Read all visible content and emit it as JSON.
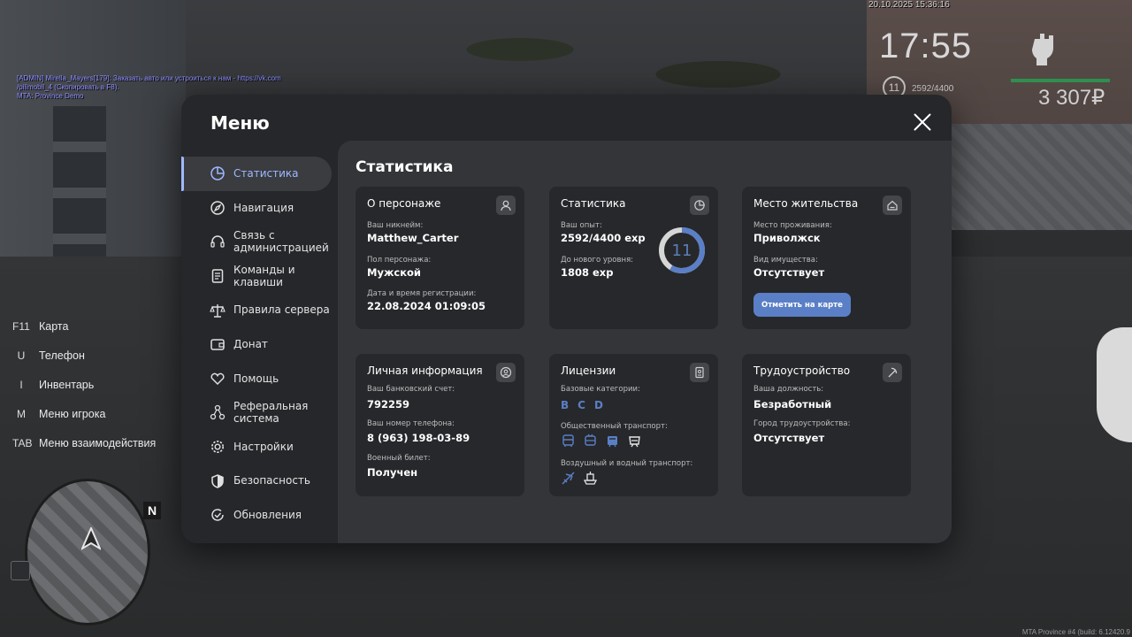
{
  "chat": [
    "[ADMIN] Mirella_Mayers[179]: Заказать авто или устроиться к нам - https://vk.com",
    "/pilimobil_4 (Скопировать в F8).",
    "MTA: Province Demo"
  ],
  "hud": {
    "datetime": "20.10.2025 15:36:16",
    "time": "17:55",
    "level": "11",
    "exp": "2592/4400",
    "money": "3 307₽",
    "health_color": "#2f8f4e"
  },
  "hotkeys": [
    {
      "key": "F11",
      "label": "Карта"
    },
    {
      "key": "U",
      "label": "Телефон"
    },
    {
      "key": "I",
      "label": "Инвентарь"
    },
    {
      "key": "M",
      "label": "Меню игрока"
    },
    {
      "key": "TAB",
      "label": "Меню взаимодействия"
    }
  ],
  "minimap": {
    "north": "N"
  },
  "build": "MTA Province #4 (build: 6.12420.9",
  "menu": {
    "title": "Меню",
    "nav": [
      {
        "label": "Статистика",
        "icon": "pie-chart-icon",
        "active": true
      },
      {
        "label": "Навигация",
        "icon": "compass-icon"
      },
      {
        "label": "Связь с администрацией",
        "icon": "headset-icon"
      },
      {
        "label": "Команды и клавиши",
        "icon": "document-icon"
      },
      {
        "label": "Правила сервера",
        "icon": "scales-icon"
      },
      {
        "label": "Донат",
        "icon": "wallet-icon"
      },
      {
        "label": "Помощь",
        "icon": "heart-hands-icon"
      },
      {
        "label": "Реферальная система",
        "icon": "network-icon"
      },
      {
        "label": "Настройки",
        "icon": "gear-icon"
      },
      {
        "label": "Безопасность",
        "icon": "shield-icon"
      },
      {
        "label": "Обновления",
        "icon": "refresh-check-icon"
      }
    ],
    "accent": "#5a7fc6"
  },
  "stats": {
    "title": "Статистика",
    "character": {
      "title": "О персонаже",
      "nickname_label": "Ваш никнейм:",
      "nickname": "Matthew_Carter",
      "gender_label": "Пол персонажа:",
      "gender": "Мужской",
      "reg_label": "Дата и время регистрации:",
      "reg": "22.08.2024 01:09:05"
    },
    "statistics": {
      "title": "Статистика",
      "exp_label": "Ваш опыт:",
      "exp": "2592/4400 exp",
      "next_label": "До нового уровня:",
      "next": "1808 exp",
      "level": "11",
      "progress": 0.589
    },
    "residence": {
      "title": "Место жительства",
      "place_label": "Место проживания:",
      "place": "Приволжск",
      "property_label": "Вид имущества:",
      "property": "Отсутствует",
      "button": "Отметить на карте"
    },
    "personal": {
      "title": "Личная информация",
      "bank_label": "Ваш банковский счет:",
      "bank": "792259",
      "phone_label": "Ваш номер телефона:",
      "phone": "8 (963) 198-03-89",
      "military_label": "Военный билет:",
      "military": "Получен"
    },
    "licenses": {
      "title": "Лицензии",
      "base_label": "Базовые категории:",
      "categories": [
        "B",
        "C",
        "D"
      ],
      "public_label": "Общественный транспорт:",
      "air_label": "Воздушный и водный транспорт:"
    },
    "employment": {
      "title": "Трудоустройство",
      "position_label": "Ваша должность:",
      "position": "Безработный",
      "city_label": "Город трудоустройства:",
      "city": "Отсутствует"
    }
  }
}
